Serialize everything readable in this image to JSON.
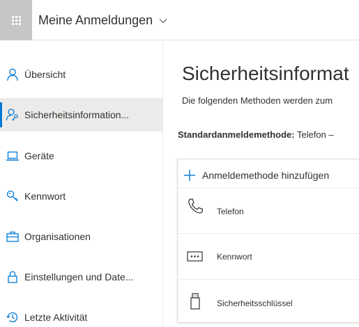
{
  "header": {
    "app_title": "Meine Anmeldungen",
    "waffle_icon": "app-launcher-icon",
    "chevron_icon": "chevron-down-icon"
  },
  "sidebar": {
    "items": [
      {
        "label": "Übersicht",
        "icon": "person-icon",
        "active": false
      },
      {
        "label": "Sicherheitsinformation...",
        "icon": "person-key-icon",
        "active": true
      },
      {
        "label": "Geräte",
        "icon": "laptop-icon",
        "active": false
      },
      {
        "label": "Kennwort",
        "icon": "key-icon",
        "active": false
      },
      {
        "label": "Organisationen",
        "icon": "briefcase-icon",
        "active": false
      },
      {
        "label": "Einstellungen und Date...",
        "icon": "lock-icon",
        "active": false
      },
      {
        "label": "Letzte Aktivität",
        "icon": "history-icon",
        "active": false
      }
    ]
  },
  "main": {
    "title": "Sicherheitsinformat",
    "description": "Die folgenden Methoden werden zum",
    "default_method_label": "Standardanmeldemethode:",
    "default_method_value": " Telefon –",
    "add_method_label": "Anmeldemethode hinzufügen",
    "methods": [
      {
        "label": "Telefon",
        "icon": "phone-icon"
      },
      {
        "label": "Kennwort",
        "icon": "password-dots-icon"
      },
      {
        "label": "Sicherheitsschlüssel",
        "icon": "usb-key-icon"
      }
    ]
  },
  "colors": {
    "accent": "#0078d4",
    "active_bg": "#edebe9",
    "waffle_bg": "#c8c6c4"
  }
}
